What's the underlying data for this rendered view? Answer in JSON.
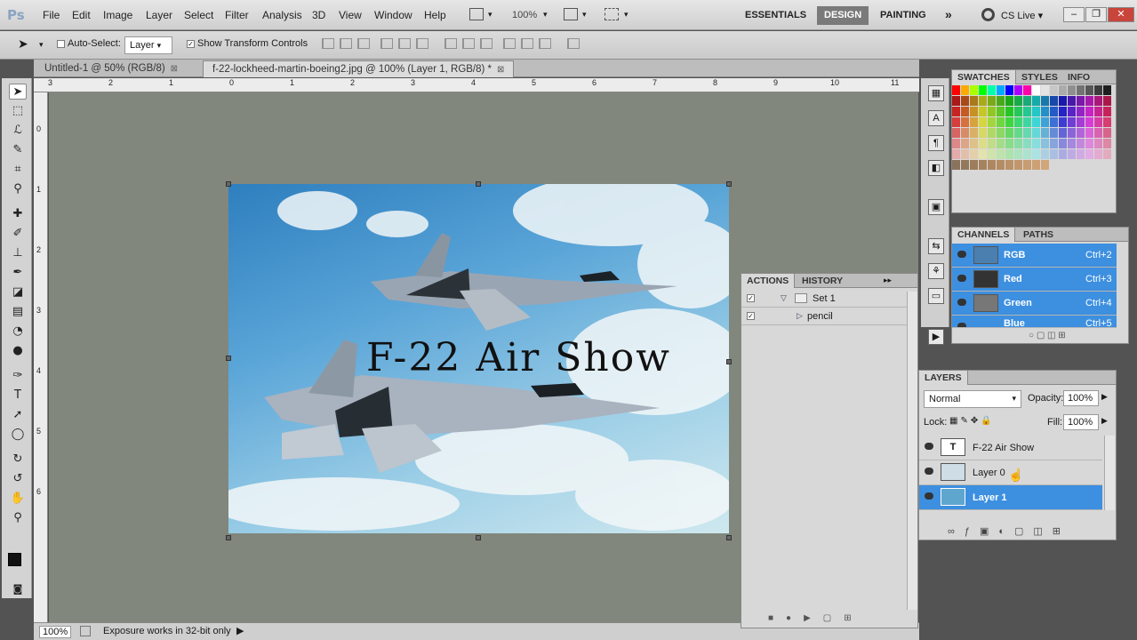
{
  "app": {
    "logo": "Ps"
  },
  "menu": [
    "File",
    "Edit",
    "Image",
    "Layer",
    "Select",
    "Filter",
    "Analysis",
    "3D",
    "View",
    "Window",
    "Help"
  ],
  "top_controls": {
    "zoom": "100%"
  },
  "workspaces": {
    "essentials": "ESSENTIALS",
    "design": "DESIGN",
    "painting": "PAINTING",
    "more": "»",
    "cs_live": "CS Live ▾"
  },
  "window_controls": {
    "minimize": "–",
    "restore": "❐",
    "close": "✕"
  },
  "options_bar": {
    "auto_select_label": "Auto-Select:",
    "auto_select_value": "Layer",
    "transform_label": "Show Transform Controls"
  },
  "tabs": [
    {
      "label": "Untitled-1 @ 50% (RGB/8)",
      "close": "⊠"
    },
    {
      "label": "f-22-lockheed-martin-boeing2.jpg @ 100% (Layer 1, RGB/8) *",
      "close": "⊠"
    }
  ],
  "ruler_top": [
    "3",
    "2",
    "1",
    "0",
    "1",
    "2",
    "3",
    "4",
    "5",
    "6",
    "7",
    "8",
    "9",
    "10",
    "11"
  ],
  "ruler_left": [
    "0",
    "1",
    "2",
    "3",
    "4",
    "5",
    "6"
  ],
  "artwork": {
    "title": "F-22  Air Show"
  },
  "status": {
    "zoom": "100%",
    "message": "Exposure works in 32-bit only"
  },
  "swatches_panel": {
    "tabs": [
      "SWATCHES",
      "STYLES",
      "INFO"
    ]
  },
  "channels_panel": {
    "tabs": [
      "CHANNELS",
      "PATHS"
    ],
    "rows": [
      {
        "name": "RGB",
        "shortcut": "Ctrl+2"
      },
      {
        "name": "Red",
        "shortcut": "Ctrl+3"
      },
      {
        "name": "Green",
        "shortcut": "Ctrl+4"
      },
      {
        "name": "Blue",
        "shortcut": "Ctrl+5"
      }
    ]
  },
  "actions_panel": {
    "tabs": [
      "ACTIONS",
      "HISTORY"
    ],
    "more": "▸▸",
    "rows": [
      {
        "name": "Set 1"
      },
      {
        "name": "pencil"
      }
    ]
  },
  "layers_panel": {
    "tab": "LAYERS",
    "blend_mode": "Normal",
    "opacity_label": "Opacity:",
    "opacity_value": "100%",
    "lock_label": "Lock:",
    "fill_label": "Fill:",
    "fill_value": "100%",
    "layers": [
      {
        "name": "F-22 Air Show",
        "thumb": "T"
      },
      {
        "name": "Layer 0"
      },
      {
        "name": "Layer 1"
      }
    ]
  },
  "colors": {
    "accent": "#3d8fe0",
    "canvas_bg": "#81877c"
  }
}
